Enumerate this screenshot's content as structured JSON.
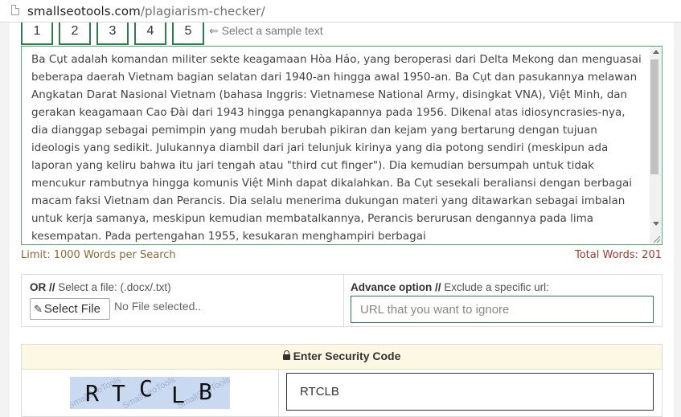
{
  "browser": {
    "url_host": "smallseotools.com",
    "url_path": "/plagiarism-checker/"
  },
  "sample": {
    "tabs": [
      "1",
      "2",
      "3",
      "4",
      "5"
    ],
    "hint": "⇐ Select a sample text"
  },
  "editor": {
    "text": "Ba Cụt adalah komandan militer sekte keagamaan Hòa Hảo, yang beroperasi dari Delta Mekong dan menguasai beberapa daerah Vietnam bagian selatan dari 1940-an hingga awal 1950-an. Ba Cụt dan pasukannya melawan Angkatan Darat Nasional Vietnam (bahasa Inggris: Vietnamese National Army, disingkat VNA), Việt Minh, dan gerakan keagamaan Cao Đài dari 1943 hingga penangkapannya pada 1956. Dikenal atas idiosyncrasies-nya, dia dianggap sebagai pemimpin yang mudah berubah pikiran dan kejam yang bertarung dengan tujuan ideologis yang sedikit. Julukannya diambil dari jari telunjuk kirinya yang dia potong sendiri (meskipun ada laporan yang keliru bahwa itu jari tengah atau \"third cut finger\"). Dia kemudian bersumpah untuk tidak mencukur rambutnya hingga komunis Việt Minh dapat dikalahkan. Ba Cụt sesekali beraliansi dengan berbagai macam faksi Vietnam dan Perancis. Dia selalu menerima dukungan materi yang ditawarkan sebagai imbalan untuk kerja samanya, meskipun kemudian membatalkannya, Perancis berurusan dengannya pada lima kesempatan. Pada pertengahan 1955, kesukaran menghampiri berbagai",
    "limit": "Limit: 1000 Words per Search",
    "total_words": "Total Words: 201"
  },
  "file_option": {
    "label_bold": "OR //",
    "label_rest": " Select a file: (.docx/.txt)",
    "button_label": "Select File",
    "status": "No File selected.."
  },
  "advance_option": {
    "label_bold": "Advance option //",
    "label_rest": " Exclude a specific url:",
    "placeholder": "URL that you want to ignore"
  },
  "security": {
    "header": "Enter Security Code",
    "captcha_letters": [
      "R",
      "T",
      "C",
      "L",
      "B"
    ],
    "captcha_watermark": "SmallSeoTools",
    "input_value": "RTCLB"
  },
  "icons": {
    "page": "page-icon",
    "clip": "paperclip-icon",
    "lock": "lock-icon"
  },
  "colors": {
    "accent_green": "#2e7d4f",
    "limit_text": "#8b6a35",
    "total_text": "#a33b2b",
    "security_header_bg": "#fcf8e3"
  }
}
